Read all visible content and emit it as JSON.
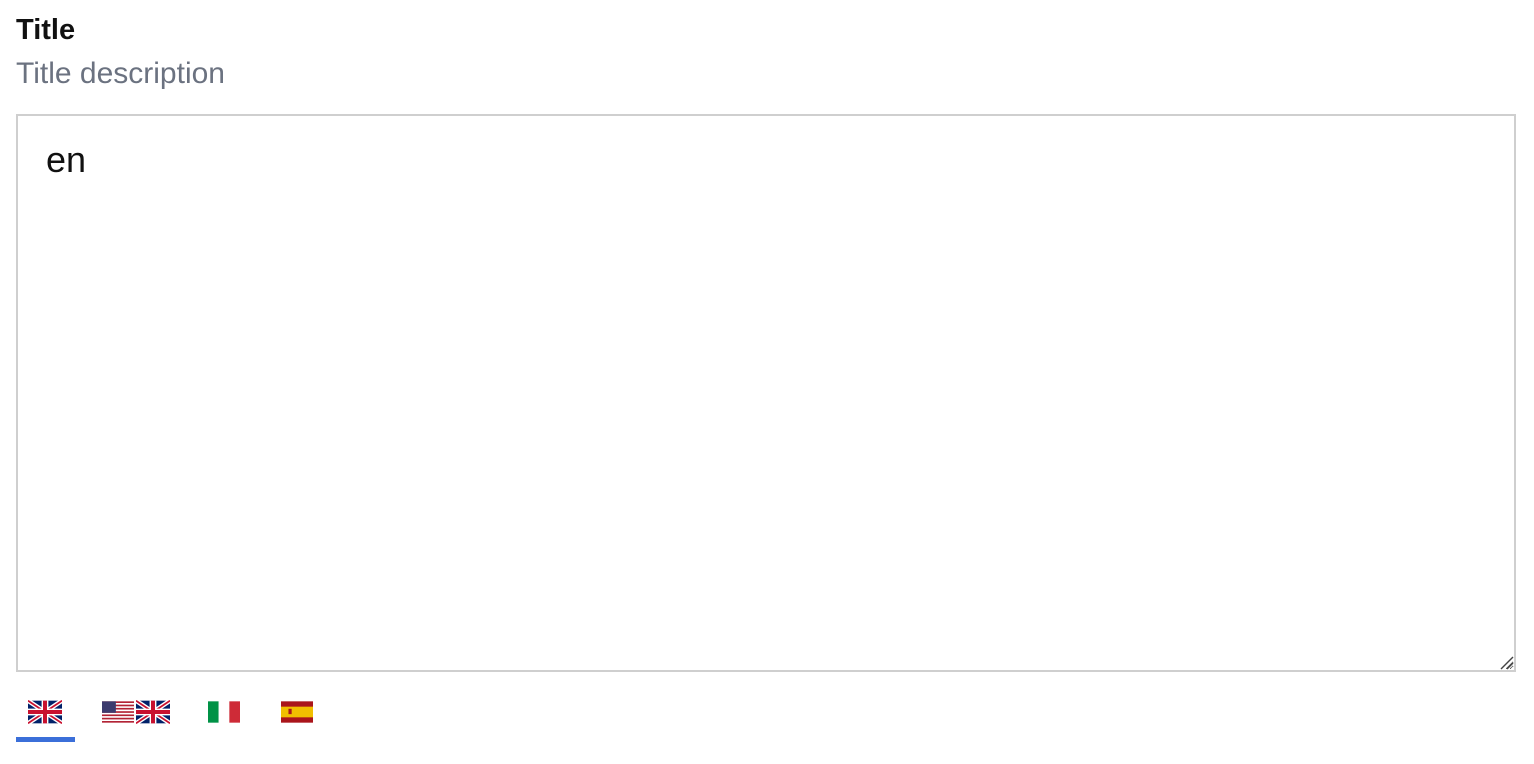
{
  "field": {
    "title": "Title",
    "description": "Title description",
    "value": "en"
  },
  "language_tabs": [
    {
      "id": "en",
      "flag": "uk-flag-icon",
      "active": true
    },
    {
      "id": "en-US",
      "flag": "us-uk-flag-icon",
      "active": false
    },
    {
      "id": "it",
      "flag": "italy-flag-icon",
      "active": false
    },
    {
      "id": "es",
      "flag": "spain-flag-icon",
      "active": false
    }
  ],
  "colors": {
    "accent": "#3b6fd9",
    "description_text": "#6b7280",
    "border": "#cfcfcf"
  }
}
